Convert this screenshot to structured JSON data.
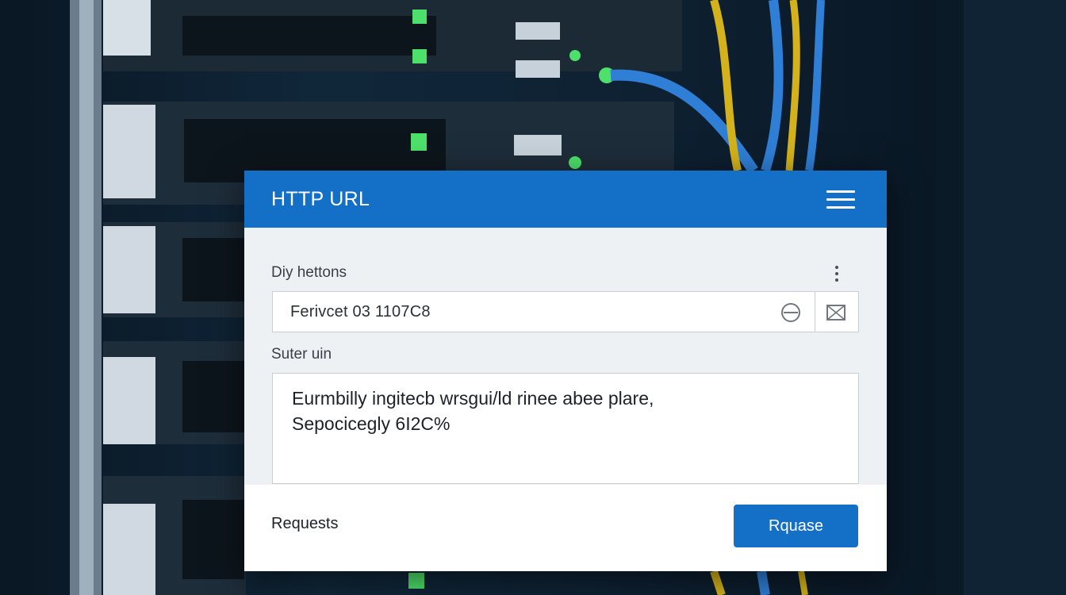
{
  "dialog": {
    "title": "HTTP URL",
    "url_section_label": "Diy hettons",
    "url_value": "Ferivcet 03 1107C8",
    "body_section_label": "Suter uin",
    "body_lines": [
      "Eurmbilly ingitecb wrsgui/ld rinee abee plare,",
      "Sepocicegly 6I2C%"
    ],
    "footer_label": "Requests",
    "send_label": "Rquase"
  },
  "icons": {
    "menu": "hamburger-menu-icon",
    "more": "vertical-ellipsis-icon",
    "clear": "circle-minus-icon",
    "action": "envelope-icon"
  },
  "colors": {
    "accent": "#1470c6",
    "panel": "#eef1f4",
    "server_led": "#4de06a",
    "cable_blue": "#2f7fd6",
    "cable_yellow": "#d4b21c"
  }
}
